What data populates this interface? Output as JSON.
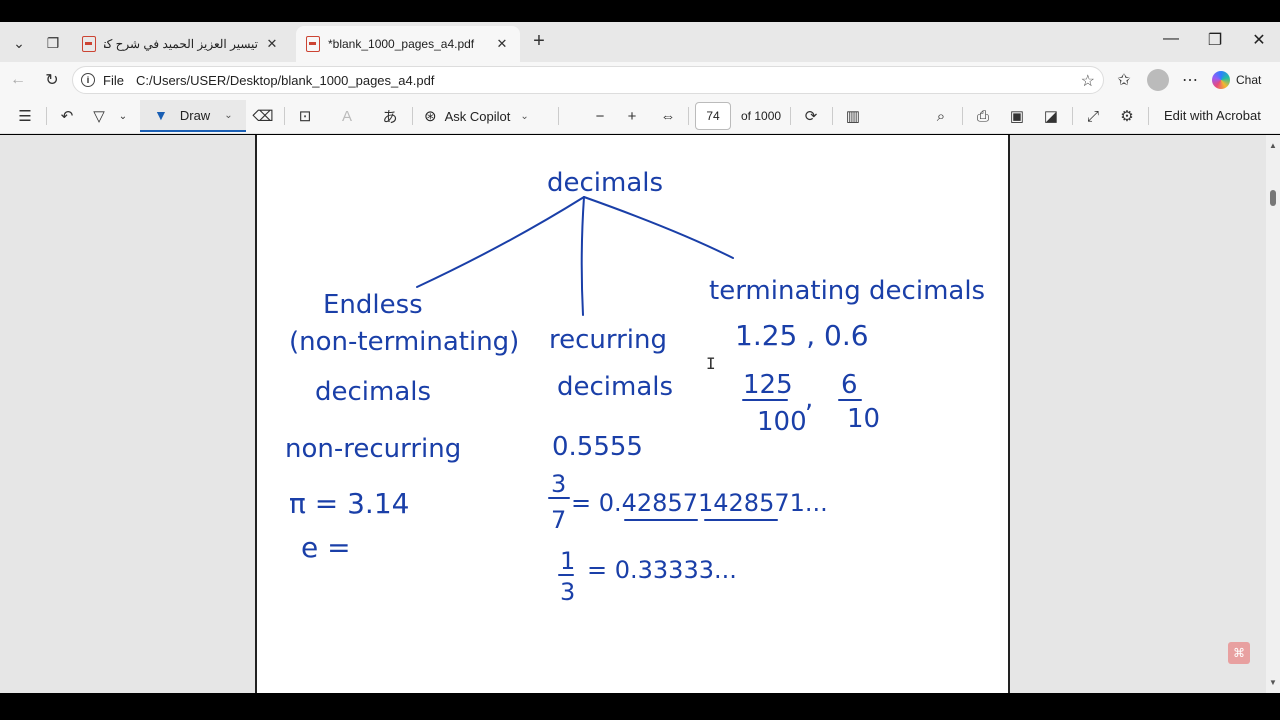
{
  "browser": {
    "tabs": [
      {
        "title": "تيسير العزيز الحميد في شرح كتاب الت",
        "active": false
      },
      {
        "title": "*blank_1000_pages_a4.pdf",
        "active": true
      }
    ],
    "address": {
      "scheme": "File",
      "url": "C:/Users/USER/Desktop/blank_1000_pages_a4.pdf"
    },
    "chat_label": "Chat"
  },
  "pdf_toolbar": {
    "draw_label": "Draw",
    "copilot_label": "Ask Copilot",
    "page_number": "74",
    "page_total": "of 1000",
    "edit_label": "Edit with Acrobat"
  },
  "notes": {
    "root": "decimals",
    "branches": {
      "left": {
        "line1": "Endless",
        "line2": "(non-terminating)",
        "line3": "decimals",
        "subtitle": "non-recurring",
        "ex1": "π = 3.14",
        "ex2": "e ="
      },
      "middle": {
        "line1": "recurring",
        "line2": "decimals",
        "ex0": "0.5555",
        "ex1_num": "3",
        "ex1_den": "7",
        "ex1_rhs": "= 0.428571428571...",
        "ex2_num": "1",
        "ex2_den": "3",
        "ex2_rhs": "= 0.33333..."
      },
      "right": {
        "title": "terminating decimals",
        "ex": "1.25 , 0.6",
        "f1_num": "125",
        "f1_den": "100",
        "comma": ",",
        "f2_num": "6",
        "f2_den": "10"
      }
    }
  },
  "colors": {
    "ink": "#1a3fa8",
    "accent": "#1a5fb4"
  }
}
